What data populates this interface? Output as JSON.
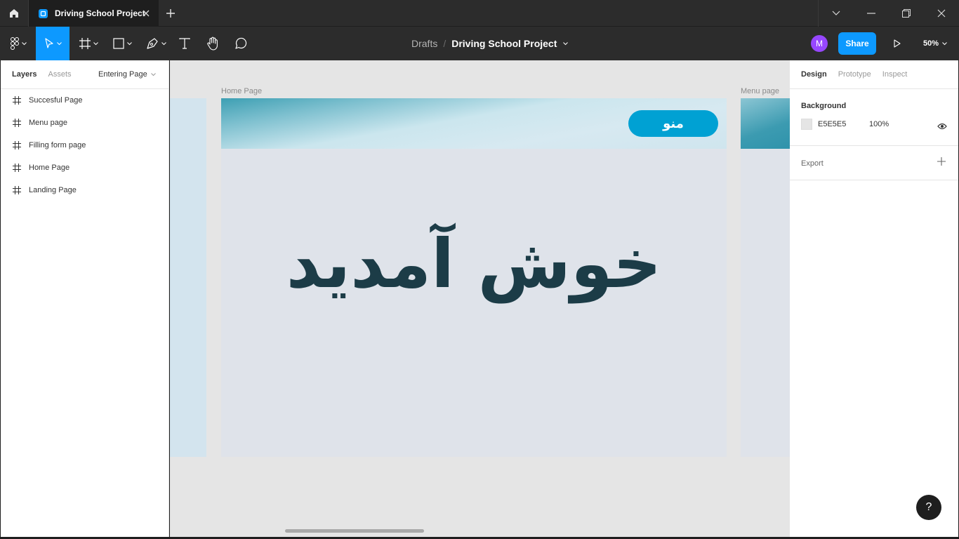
{
  "titlebar": {
    "tab_title": "Driving School Project"
  },
  "toolbar": {
    "breadcrumb_drafts": "Drafts",
    "breadcrumb_sep": "/",
    "breadcrumb_file": "Driving School Project",
    "avatar_initial": "M",
    "share_label": "Share",
    "zoom_label": "50%"
  },
  "left_panel": {
    "tabs": [
      "Layers",
      "Assets"
    ],
    "current_page": "Entering Page",
    "layers": [
      "Succesful Page",
      "Menu page",
      "Filling form page",
      "Home Page",
      "Landing Page"
    ]
  },
  "canvas": {
    "frame_main_label": "Home Page",
    "frame_right_label": "Menu page",
    "menu_button_text": "منو",
    "welcome_text": "خوش آمدید"
  },
  "right_panel": {
    "tabs": [
      "Design",
      "Prototype",
      "Inspect"
    ],
    "background_title": "Background",
    "background_hex": "E5E5E5",
    "background_opacity": "100%",
    "export_title": "Export"
  },
  "help_label": "?",
  "colors": {
    "accent": "#0d99ff",
    "avatar": "#9747ff",
    "menu_button": "#00a1d3",
    "welcome_text": "#1c3c47"
  }
}
